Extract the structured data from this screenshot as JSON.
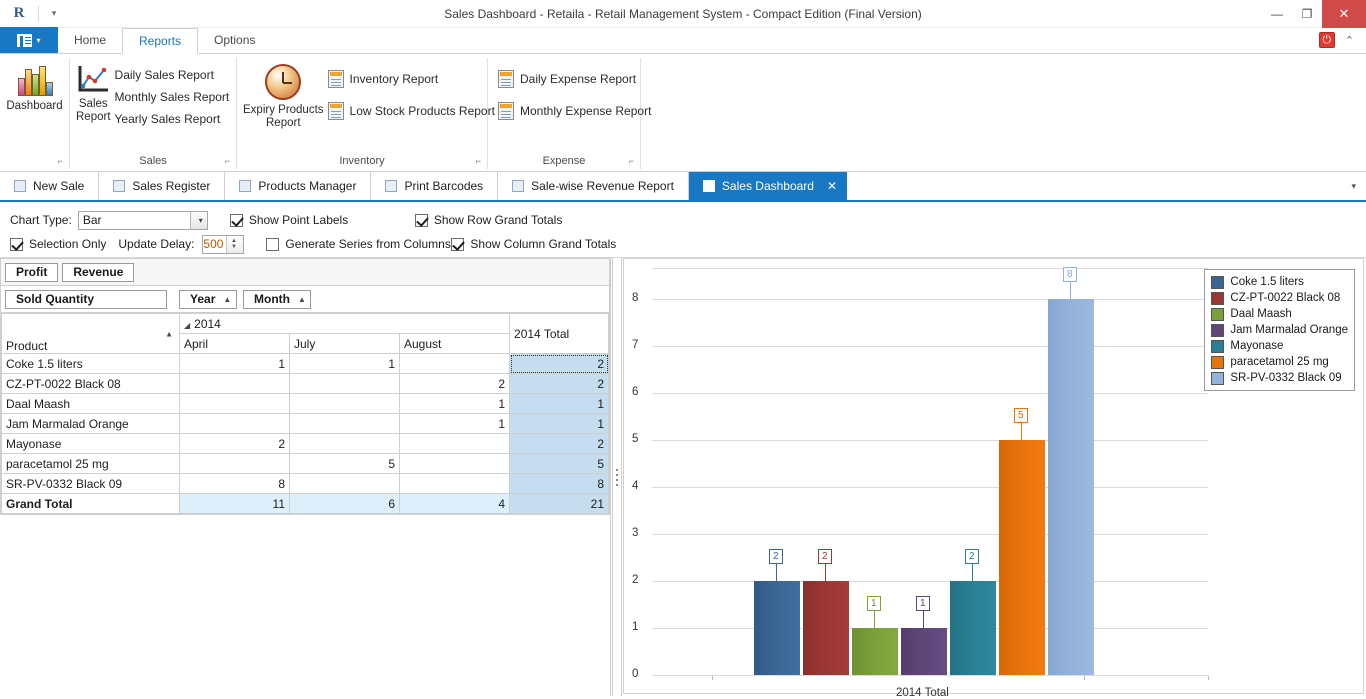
{
  "window": {
    "title": "Sales Dashboard - Retaila - Retail Management System - Compact Edition (Final Version)",
    "app_glyph": "R",
    "qat_dropdown": "▾",
    "minimize": "—",
    "restore": "❐",
    "close": "✕"
  },
  "ribbon": {
    "file_caret": "▾",
    "tabs": [
      {
        "label": "Home",
        "active": false
      },
      {
        "label": "Reports",
        "active": true
      },
      {
        "label": "Options",
        "active": false
      }
    ],
    "power_icon": "⏻",
    "collapse_icon": "⌃",
    "groups": [
      {
        "name": "",
        "title": "",
        "launcher": "⌐",
        "big_buttons": [
          {
            "label": "Dashboard",
            "icon": "dashboard-icon"
          }
        ],
        "menu_items": []
      },
      {
        "name": "sales",
        "title": "Sales",
        "launcher": "⌐",
        "big_buttons": [
          {
            "label": "Sales\nReport",
            "icon": "sales-report-icon"
          }
        ],
        "menu_items": [
          {
            "label": "Daily Sales Report"
          },
          {
            "label": "Monthly Sales Report"
          },
          {
            "label": "Yearly Sales Report"
          }
        ]
      },
      {
        "name": "inventory",
        "title": "Inventory",
        "launcher": "⌐",
        "big_buttons": [
          {
            "label": "Expiry Products\nReport",
            "icon": "clock-icon"
          }
        ],
        "menu_items": [
          {
            "label": "Inventory Report"
          },
          {
            "label": "Low Stock Products Report"
          }
        ]
      },
      {
        "name": "expense",
        "title": "Expense",
        "launcher": "⌐",
        "big_buttons": [],
        "menu_items": [
          {
            "label": "Daily Expense Report"
          },
          {
            "label": "Monthly Expense Report"
          }
        ]
      }
    ]
  },
  "doc_tabs": {
    "items": [
      {
        "label": "New Sale",
        "active": false
      },
      {
        "label": "Sales Register",
        "active": false
      },
      {
        "label": "Products Manager",
        "active": false
      },
      {
        "label": "Print Barcodes",
        "active": false
      },
      {
        "label": "Sale-wise Revenue Report",
        "active": false
      },
      {
        "label": "Sales Dashboard",
        "active": true,
        "close": "✕"
      }
    ],
    "overflow_caret": "▾"
  },
  "options": {
    "chart_type_label": "Chart Type:",
    "chart_type_value": "Bar",
    "chart_type_caret": "▾",
    "selection_only": {
      "label": "Selection Only",
      "checked": true
    },
    "update_delay_label": "Update Delay:",
    "update_delay_value": "500",
    "spin_up": "▲",
    "spin_down": "▼",
    "show_point_labels": {
      "label": "Show Point Labels",
      "checked": true
    },
    "generate_series": {
      "label": "Generate Series from Columns",
      "checked": false
    },
    "show_row_grand_totals": {
      "label": "Show Row Grand Totals",
      "checked": true
    },
    "show_column_grand_totals": {
      "label": "Show Column Grand Totals",
      "checked": true
    }
  },
  "field_chooser": {
    "fields": [
      "Profit",
      "Revenue"
    ]
  },
  "pivot": {
    "data_field": "Sold Quantity",
    "column_fields": [
      {
        "label": "Year",
        "sort": "▲"
      },
      {
        "label": "Month",
        "sort": "▲"
      }
    ],
    "row_field": {
      "label": "Product",
      "sort": "▲"
    },
    "column_group": {
      "expander": "◢",
      "label": "2014"
    },
    "column_headers": [
      "April",
      "July",
      "August"
    ],
    "total_header": "2014 Total",
    "rows": [
      {
        "product": "Coke 1.5 liters",
        "values": [
          "1",
          "1",
          ""
        ],
        "total": "2",
        "selected": true
      },
      {
        "product": "CZ-PT-0022 Black 08",
        "values": [
          "",
          "",
          "2"
        ],
        "total": "2",
        "selected": false
      },
      {
        "product": "Daal Maash",
        "values": [
          "",
          "",
          "1"
        ],
        "total": "1",
        "selected": false
      },
      {
        "product": "Jam Marmalad Orange",
        "values": [
          "",
          "",
          "1"
        ],
        "total": "1",
        "selected": false
      },
      {
        "product": "Mayonase",
        "values": [
          "2",
          "",
          ""
        ],
        "total": "2",
        "selected": false
      },
      {
        "product": "paracetamol 25 mg",
        "values": [
          "",
          "5",
          ""
        ],
        "total": "5",
        "selected": false
      },
      {
        "product": "SR-PV-0332 Black 09",
        "values": [
          "8",
          "",
          ""
        ],
        "total": "8",
        "selected": false
      }
    ],
    "grand_total": {
      "label": "Grand Total",
      "values": [
        "11",
        "6",
        "4"
      ],
      "total": "21"
    }
  },
  "chart_data": {
    "type": "bar",
    "title": "",
    "xlabel": "2014 Total",
    "ylabel": "",
    "categories": [
      "2014 Total"
    ],
    "ylim": [
      0,
      8.7
    ],
    "yticks": [
      0,
      1,
      2,
      3,
      4,
      5,
      6,
      7,
      8
    ],
    "grid": true,
    "legend_position": "right",
    "series": [
      {
        "name": "Coke 1.5 liters",
        "values": [
          2
        ],
        "color": "#3a6695",
        "label": "2"
      },
      {
        "name": "CZ-PT-0022 Black 08",
        "values": [
          2
        ],
        "color": "#9b3635",
        "label": "2"
      },
      {
        "name": "Daal Maash",
        "values": [
          1
        ],
        "color": "#7ba03a",
        "label": "1"
      },
      {
        "name": "Jam Marmalad Orange",
        "values": [
          1
        ],
        "color": "#5f4677",
        "label": "1"
      },
      {
        "name": "Mayonase",
        "values": [
          2
        ],
        "color": "#2a7f94",
        "label": "2"
      },
      {
        "name": "paracetamol 25 mg",
        "values": [
          5
        ],
        "color": "#e8730c",
        "label": "5"
      },
      {
        "name": "SR-PV-0332 Black 09",
        "values": [
          8
        ],
        "color": "#93b2d9",
        "label": "8"
      }
    ]
  },
  "colors": {
    "accent": "#1878c4",
    "close_red": "#d04a4a",
    "total_fill": "#c4deef",
    "grand_fill": "#ddeffa"
  }
}
